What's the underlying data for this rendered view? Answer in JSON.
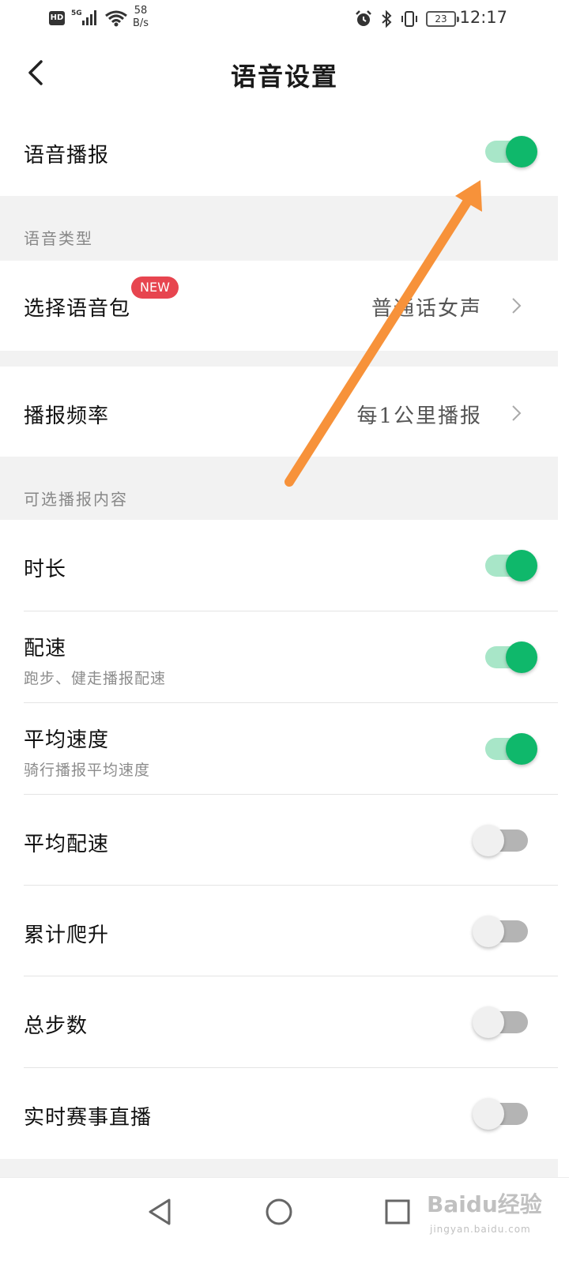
{
  "status_bar": {
    "hd": "HD",
    "network": "5G",
    "speed_value": "58",
    "speed_unit": "B/s",
    "battery": "23",
    "time": "12:17"
  },
  "header": {
    "title": "语音设置",
    "back_icon": "chevron-left-icon"
  },
  "voice_broadcast": {
    "label": "语音播报",
    "enabled": true
  },
  "voice_type_section": {
    "title": "语音类型"
  },
  "voice_pack": {
    "label": "选择语音包",
    "badge": "NEW",
    "value": "普通话女声"
  },
  "frequency": {
    "label": "播报频率",
    "value": "每1公里播报"
  },
  "optional_section": {
    "title": "可选播报内容"
  },
  "options": [
    {
      "label": "时长",
      "sub": "",
      "enabled": true
    },
    {
      "label": "配速",
      "sub": "跑步、健走播报配速",
      "enabled": true
    },
    {
      "label": "平均速度",
      "sub": "骑行播报平均速度",
      "enabled": true
    },
    {
      "label": "平均配速",
      "sub": "",
      "enabled": false
    },
    {
      "label": "累计爬升",
      "sub": "",
      "enabled": false
    },
    {
      "label": "总步数",
      "sub": "",
      "enabled": false
    },
    {
      "label": "实时赛事直播",
      "sub": "",
      "enabled": false
    }
  ],
  "colors": {
    "toggle_on": "#0fb86b",
    "toggle_on_track": "#a8e6c8",
    "toggle_off_track": "#b4b4b4",
    "badge": "#e7454f",
    "annotation_arrow": "#f7923a"
  },
  "nav_bar": {
    "back": "triangle-back-icon",
    "home": "circle-home-icon",
    "recents": "square-recents-icon"
  },
  "watermark": {
    "logo": "Baidu经验",
    "sub": "jingyan.baidu.com"
  }
}
